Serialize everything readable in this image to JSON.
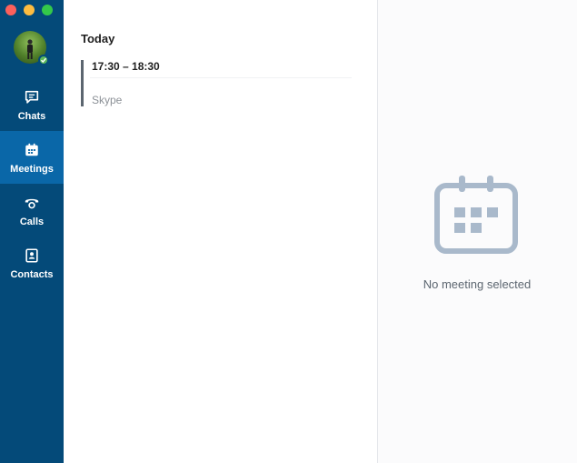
{
  "window": {
    "controls": [
      "close",
      "minimize",
      "zoom"
    ]
  },
  "sidebar": {
    "presence": "online",
    "items": [
      {
        "label": "Chats",
        "icon": "chat-icon",
        "active": false
      },
      {
        "label": "Meetings",
        "icon": "calendar-icon",
        "active": true
      },
      {
        "label": "Calls",
        "icon": "phone-icon",
        "active": false
      },
      {
        "label": "Contacts",
        "icon": "contacts-icon",
        "active": false
      }
    ]
  },
  "meetings": {
    "section_title": "Today",
    "items": [
      {
        "time": "17:30 – 18:30",
        "source": "Skype"
      }
    ]
  },
  "detail": {
    "empty_text": "No meeting selected",
    "icon": "calendar-icon"
  },
  "colors": {
    "sidebar": "#044a79",
    "sidebar_active": "#0a67a8",
    "empty_icon": "#a9b9cb"
  }
}
